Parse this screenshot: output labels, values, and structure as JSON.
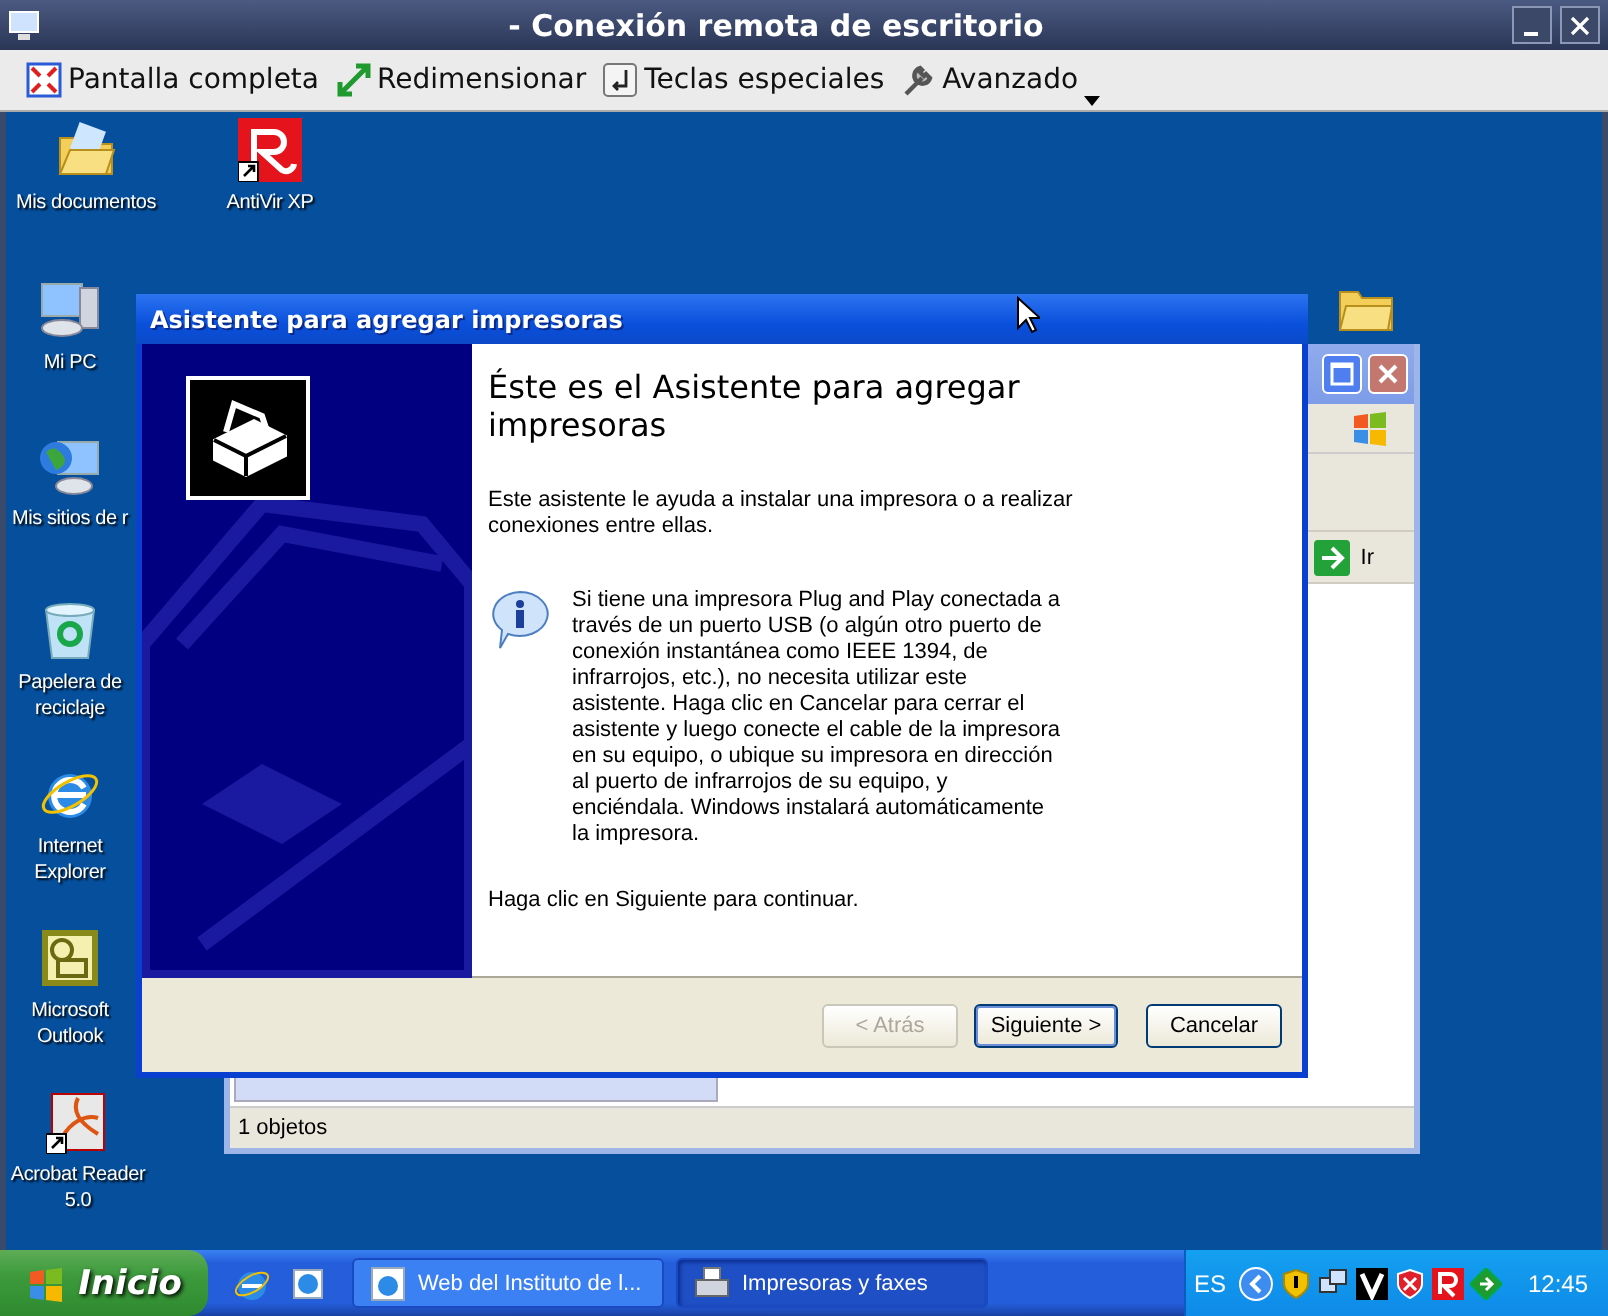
{
  "window": {
    "title": "- Conexión remota de escritorio"
  },
  "toolbar": [
    {
      "label": "Pantalla completa"
    },
    {
      "label": "Redimensionar"
    },
    {
      "label": "Teclas especiales"
    },
    {
      "label": "Avanzado"
    }
  ],
  "desktop_icons": [
    {
      "label": "Mis documentos"
    },
    {
      "label": "AntiVir XP"
    },
    {
      "label": "Mi PC"
    },
    {
      "label": "Mis sitios de r"
    },
    {
      "label": "Papelera de reciclaje"
    },
    {
      "label": "Internet Explorer"
    },
    {
      "label": "Microsoft Outlook"
    },
    {
      "label": "Acrobat Reader 5.0"
    }
  ],
  "explorer_window": {
    "go_button": "Ir",
    "status_bar": "1 objetos"
  },
  "dialog": {
    "title": "Asistente para agregar impresoras",
    "heading": "Éste es el Asistente para agregar impresoras",
    "intro": "Este asistente le ayuda a instalar una impresora o a realizar conexiones entre ellas.",
    "info": "Si tiene una impresora Plug and Play conectada a través de un puerto USB (o algún otro puerto de conexión instantánea como IEEE 1394, de infrarrojos, etc.), no necesita utilizar este asistente. Haga clic en Cancelar para cerrar el asistente y luego conecte el cable de la impresora en su equipo, o ubique su impresora en dirección al puerto de infrarrojos de su equipo, y enciéndala. Windows instalará automáticamente la impresora.",
    "footer": "Haga clic en Siguiente para continuar.",
    "buttons": [
      {
        "label": "< Atrás",
        "disabled": true,
        "default": false
      },
      {
        "label": "Siguiente >",
        "disabled": false,
        "default": true
      },
      {
        "label": "Cancelar",
        "disabled": false,
        "default": false
      }
    ]
  },
  "taskbar": {
    "start": "Inicio",
    "tasks": [
      {
        "label": "Web del Instituto de l...",
        "selected": false
      },
      {
        "label": "Impresoras y faxes",
        "selected": true
      }
    ],
    "language": "ES",
    "clock": "12:45"
  }
}
